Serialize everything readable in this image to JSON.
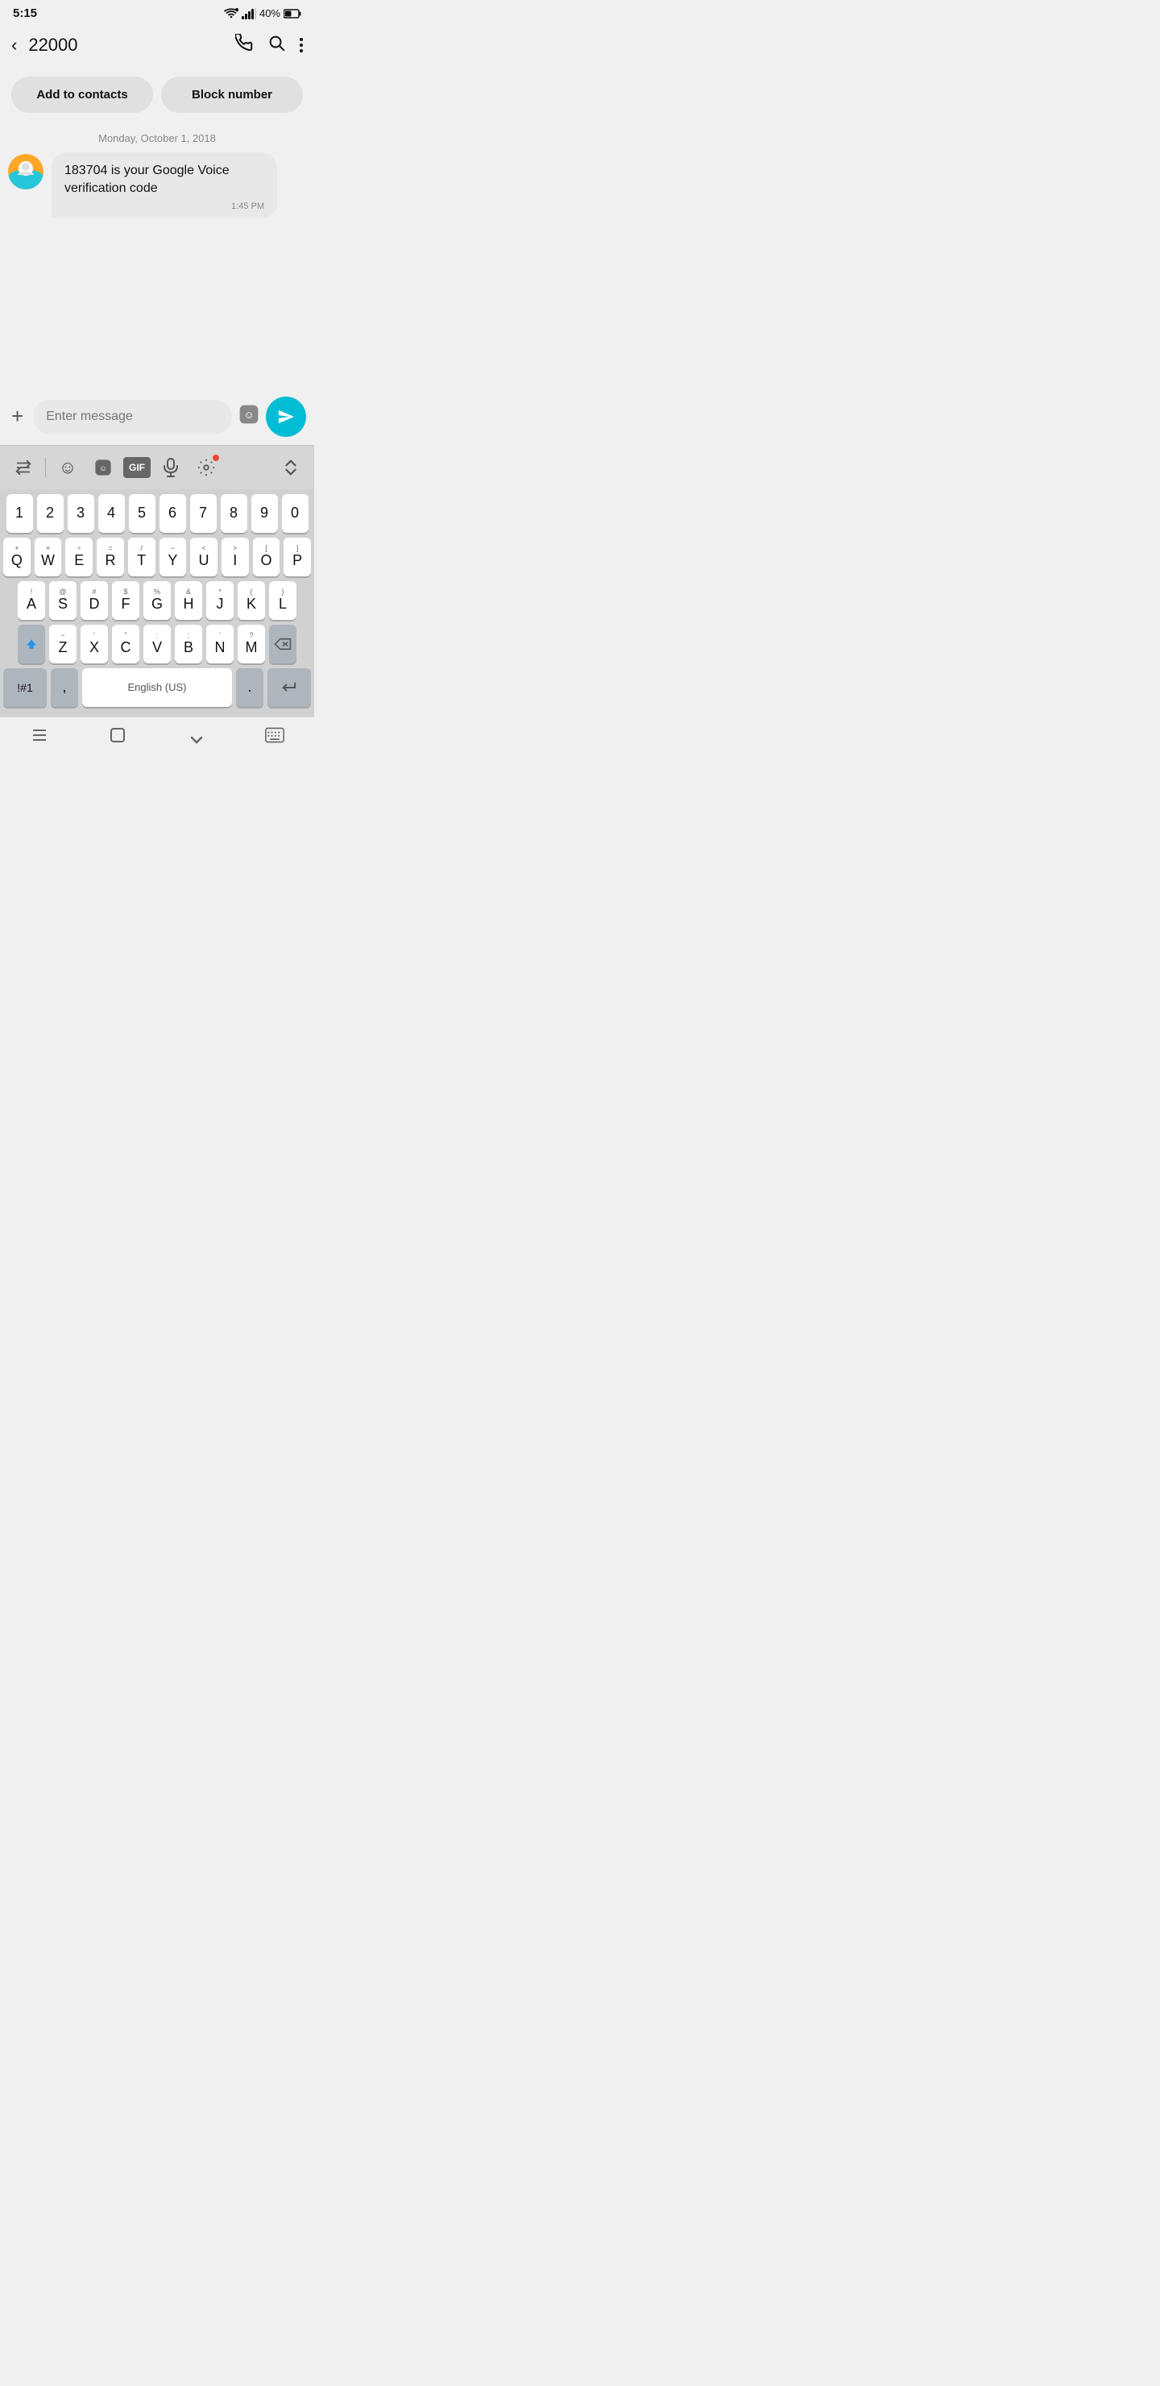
{
  "status": {
    "time": "5:15",
    "battery": "40%"
  },
  "header": {
    "title": "22000",
    "back_label": "‹"
  },
  "actions": {
    "add_contacts": "Add to contacts",
    "block_number": "Block number"
  },
  "message": {
    "date": "Monday, October 1, 2018",
    "text": "183704 is your Google Voice verification code",
    "time": "1:45 PM"
  },
  "input": {
    "placeholder": "Enter message"
  },
  "keyboard": {
    "toolbar": {
      "translate": "↺",
      "emoji": "☺",
      "sticker": "🙂",
      "gif": "GIF",
      "mic": "🎤",
      "settings": "⚙",
      "collapse": "∨"
    },
    "num_row": [
      "1",
      "2",
      "3",
      "4",
      "5",
      "6",
      "7",
      "8",
      "9",
      "0"
    ],
    "row1": [
      {
        "main": "Q",
        "sub": "+"
      },
      {
        "main": "W",
        "sub": "×"
      },
      {
        "main": "E",
        "sub": "÷"
      },
      {
        "main": "R",
        "sub": "="
      },
      {
        "main": "T",
        "sub": "/"
      },
      {
        "main": "Y",
        "sub": "−"
      },
      {
        "main": "U",
        "sub": "<"
      },
      {
        "main": "I",
        "sub": ">"
      },
      {
        "main": "O",
        "sub": "["
      },
      {
        "main": "P",
        "sub": "]"
      }
    ],
    "row2": [
      {
        "main": "A",
        "sub": "!"
      },
      {
        "main": "S",
        "sub": "@"
      },
      {
        "main": "D",
        "sub": "#"
      },
      {
        "main": "F",
        "sub": "$"
      },
      {
        "main": "G",
        "sub": "%"
      },
      {
        "main": "H",
        "sub": "&"
      },
      {
        "main": "J",
        "sub": "*"
      },
      {
        "main": "K",
        "sub": "("
      },
      {
        "main": "L",
        "sub": ")"
      }
    ],
    "row3": [
      {
        "main": "Z",
        "sub": "−"
      },
      {
        "main": "X",
        "sub": "'"
      },
      {
        "main": "C",
        "sub": "\""
      },
      {
        "main": "V",
        "sub": ":"
      },
      {
        "main": "B",
        "sub": ";"
      },
      {
        "main": "N",
        "sub": "'"
      },
      {
        "main": "M",
        "sub": "?"
      }
    ],
    "bottom": {
      "sym": "!#1",
      "comma": ",",
      "space": "English (US)",
      "period": ".",
      "enter": "↵"
    }
  },
  "nav": {
    "menu": "|||",
    "home": "□",
    "back": "∨",
    "keyboard": "⌨"
  }
}
